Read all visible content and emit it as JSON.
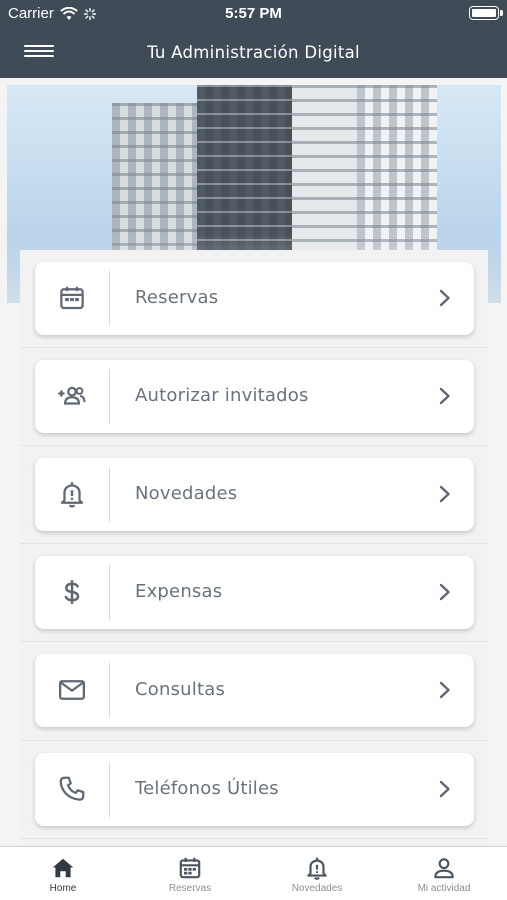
{
  "status_bar": {
    "carrier": "Carrier",
    "time": "5:57 PM"
  },
  "app_bar": {
    "title": "Tu Administración Digital",
    "menu_icon": "hamburger-menu-icon"
  },
  "menu": {
    "items": [
      {
        "label": "Reservas",
        "icon": "calendar-icon"
      },
      {
        "label": "Autorizar invitados",
        "icon": "add-group-icon"
      },
      {
        "label": "Novedades",
        "icon": "bell-alert-icon"
      },
      {
        "label": "Expensas",
        "icon": "dollar-icon"
      },
      {
        "label": "Consultas",
        "icon": "mail-icon"
      },
      {
        "label": "Teléfonos Útiles",
        "icon": "phone-icon"
      }
    ]
  },
  "tab_bar": {
    "tabs": [
      {
        "label": "Home",
        "icon": "home-icon",
        "active": true
      },
      {
        "label": "Reservas",
        "icon": "calendar-icon",
        "active": false
      },
      {
        "label": "Novedades",
        "icon": "bell-alert-icon",
        "active": false
      },
      {
        "label": "Mi actividad",
        "icon": "person-icon",
        "active": false
      }
    ]
  },
  "colors": {
    "header": "#3f4b56",
    "card_text": "#6a737c",
    "icon": "#5f6873",
    "tab_active": "#2f3a45",
    "tab_inactive": "#8a8f95"
  }
}
